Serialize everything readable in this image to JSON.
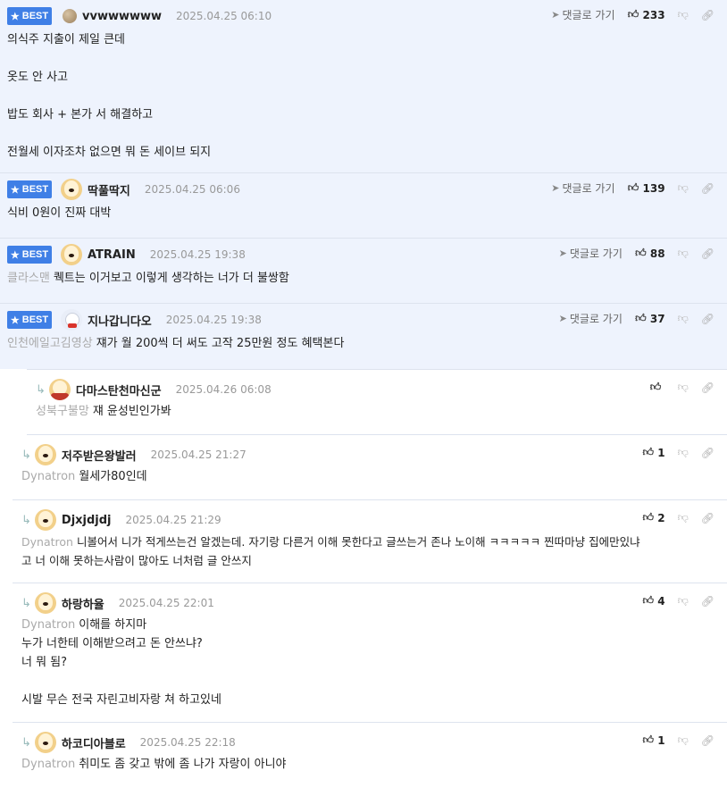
{
  "labels": {
    "best": "BEST",
    "goto": "댓글로 가기"
  },
  "comments": [
    {
      "nick": "vvwwwwww",
      "date": "2025.04.25 06:10",
      "likes": "233",
      "lines": [
        "의식주 지출이 제일 큰데",
        "",
        "옷도 안 사고",
        "",
        "밥도 회사 + 본가 서 해결하고",
        "",
        "전월세 이자조차 없으면 뭐 돈 세이브 되지"
      ]
    },
    {
      "nick": "딱풀딱지",
      "date": "2025.04.25 06:06",
      "likes": "139",
      "lines": [
        "식비 0원이 진짜 대박"
      ]
    },
    {
      "nick": "ATRAIN",
      "date": "2025.04.25 19:38",
      "likes": "88",
      "tag": "클라스맨",
      "lines": [
        "퀙트는 이거보고 이렇게 생각하는 너가 더 불쌍함"
      ]
    },
    {
      "nick": "지나갑니다오",
      "date": "2025.04.25 19:38",
      "likes": "37",
      "tag": "인천에일고김영상",
      "lines": [
        "쟤가 월 200씩 더 써도 고작 25만원 정도 혜택본다"
      ]
    }
  ],
  "replies": [
    {
      "nick": "다마스탄천마신군",
      "date": "2025.04.26 06:08",
      "likes": "",
      "tag": "성북구불망",
      "lines": [
        "쟤 윤성빈인가봐"
      ]
    },
    {
      "nick": "저주받은왕발러",
      "date": "2025.04.25 21:27",
      "likes": "1",
      "tag": "Dynatron",
      "lines": [
        "월세가80인데"
      ]
    },
    {
      "nick": "Djxjdjdj",
      "date": "2025.04.25 21:29",
      "likes": "2",
      "tag": "Dynatron",
      "lines": [
        "니볼어서 니가 적게쓰는건 알겠는데. 자기랑 다른거 이해 못한다고 글쓰는거 존나 노이해 ㅋㅋㅋㅋㅋ 찐따마냥 집에만있냐",
        "고 너 이해 못하는사람이 많아도 너처럼 글 안쓰지"
      ]
    },
    {
      "nick": "하랑하율",
      "date": "2025.04.25 22:01",
      "likes": "4",
      "tag": "Dynatron",
      "lines": [
        "이해를 하지마",
        "누가 너한테 이해받으려고 돈 안쓰냐?",
        "너 뭐 됨?",
        "",
        "시발 무슨 전국 자린고비자랑 쳐 하고있네"
      ]
    },
    {
      "nick": "하코디아블로",
      "date": "2025.04.25 22:18",
      "likes": "1",
      "tag": "Dynatron",
      "lines": [
        "취미도 좀 갖고 밖에 좀 나가 자랑이 아니야"
      ]
    }
  ]
}
